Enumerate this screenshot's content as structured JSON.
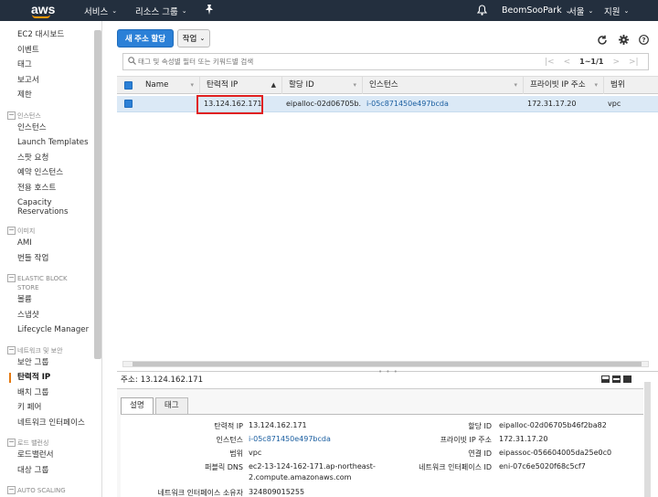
{
  "topnav": {
    "logo": "aws",
    "services": "서비스",
    "resource_groups": "리소스 그룹",
    "user": "BeomSooPark",
    "region": "서울",
    "support": "지원"
  },
  "sidebar": {
    "items": [
      {
        "type": "item",
        "label": "EC2 대시보드"
      },
      {
        "type": "item",
        "label": "이벤트"
      },
      {
        "type": "item",
        "label": "태그"
      },
      {
        "type": "item",
        "label": "보고서"
      },
      {
        "type": "item",
        "label": "제한"
      },
      {
        "type": "head",
        "label": "인스턴스"
      },
      {
        "type": "item",
        "label": "인스턴스"
      },
      {
        "type": "item",
        "label": "Launch Templates"
      },
      {
        "type": "item",
        "label": "스팟 요청"
      },
      {
        "type": "item",
        "label": "예약 인스턴스"
      },
      {
        "type": "item",
        "label": "전용 호스트"
      },
      {
        "type": "item",
        "label": "Capacity Reservations",
        "multi": true
      },
      {
        "type": "head",
        "label": "이미지"
      },
      {
        "type": "item",
        "label": "AMI"
      },
      {
        "type": "item",
        "label": "번들 작업"
      },
      {
        "type": "head",
        "label": "ELASTIC BLOCK STORE",
        "wrap": true
      },
      {
        "type": "item",
        "label": "볼륨"
      },
      {
        "type": "item",
        "label": "스냅샷"
      },
      {
        "type": "item",
        "label": "Lifecycle Manager"
      },
      {
        "type": "head",
        "label": "네트워크 및 보안"
      },
      {
        "type": "item",
        "label": "보안 그룹"
      },
      {
        "type": "item",
        "label": "탄력적 IP",
        "active": true
      },
      {
        "type": "item",
        "label": "배치 그룹"
      },
      {
        "type": "item",
        "label": "키 페어"
      },
      {
        "type": "item",
        "label": "네트워크 인터페이스"
      },
      {
        "type": "head",
        "label": "로드 밸런싱"
      },
      {
        "type": "item",
        "label": "로드밸런서"
      },
      {
        "type": "item",
        "label": "대상 그룹"
      },
      {
        "type": "head",
        "label": "AUTO SCALING"
      },
      {
        "type": "item",
        "label": "시작 구성"
      }
    ]
  },
  "toolbar": {
    "allocate_label": "새 주소 할당",
    "action_label": "작업"
  },
  "search": {
    "placeholder": "태그 및 속성별 필터 또는 키워드별 검색"
  },
  "pager": {
    "count": "1~1/1"
  },
  "table": {
    "columns": [
      "Name",
      "탄력적 IP",
      "할당 ID",
      "인스턴스",
      "프라이빗 IP 주소",
      "범위"
    ],
    "row": {
      "name": "",
      "elastic_ip": "13.124.162.171",
      "allocation_id": "eipalloc-02d06705b...",
      "instance": "i-05c871450e497bcda",
      "private_ip": "172.31.17.20",
      "scope": "vpc"
    }
  },
  "detail": {
    "address_label": "주소:",
    "address_value": "13.124.162.171",
    "tabs": [
      "설명",
      "태그"
    ],
    "left": [
      {
        "label": "탄력적 IP",
        "value": "13.124.162.171"
      },
      {
        "label": "인스턴스",
        "value": "i-05c871450e497bcda"
      },
      {
        "label": "범위",
        "value": "vpc"
      },
      {
        "label": "퍼블릭 DNS",
        "value": "ec2-13-124-162-171.ap-northeast-",
        "value2": "2.compute.amazonaws.com"
      },
      {
        "label": "네트워크 인터페이스 소유자",
        "value": "324809015255"
      }
    ],
    "right": [
      {
        "label": "할당 ID",
        "value": "eipalloc-02d06705b46f2ba82"
      },
      {
        "label": "프라이빗 IP 주소",
        "value": "172.31.17.20"
      },
      {
        "label": "연결 ID",
        "value": "eipassoc-056604005da25e0c0"
      },
      {
        "label": "네트워크 인터페이스 ID",
        "value": "eni-07c6e5020f68c5cf7"
      }
    ]
  },
  "colors": {
    "nav_bg": "#232f3e",
    "primary": "#2b80d7",
    "selected_row": "#dbe9f6",
    "highlight": "#e02020",
    "link": "#1a5ea0"
  }
}
